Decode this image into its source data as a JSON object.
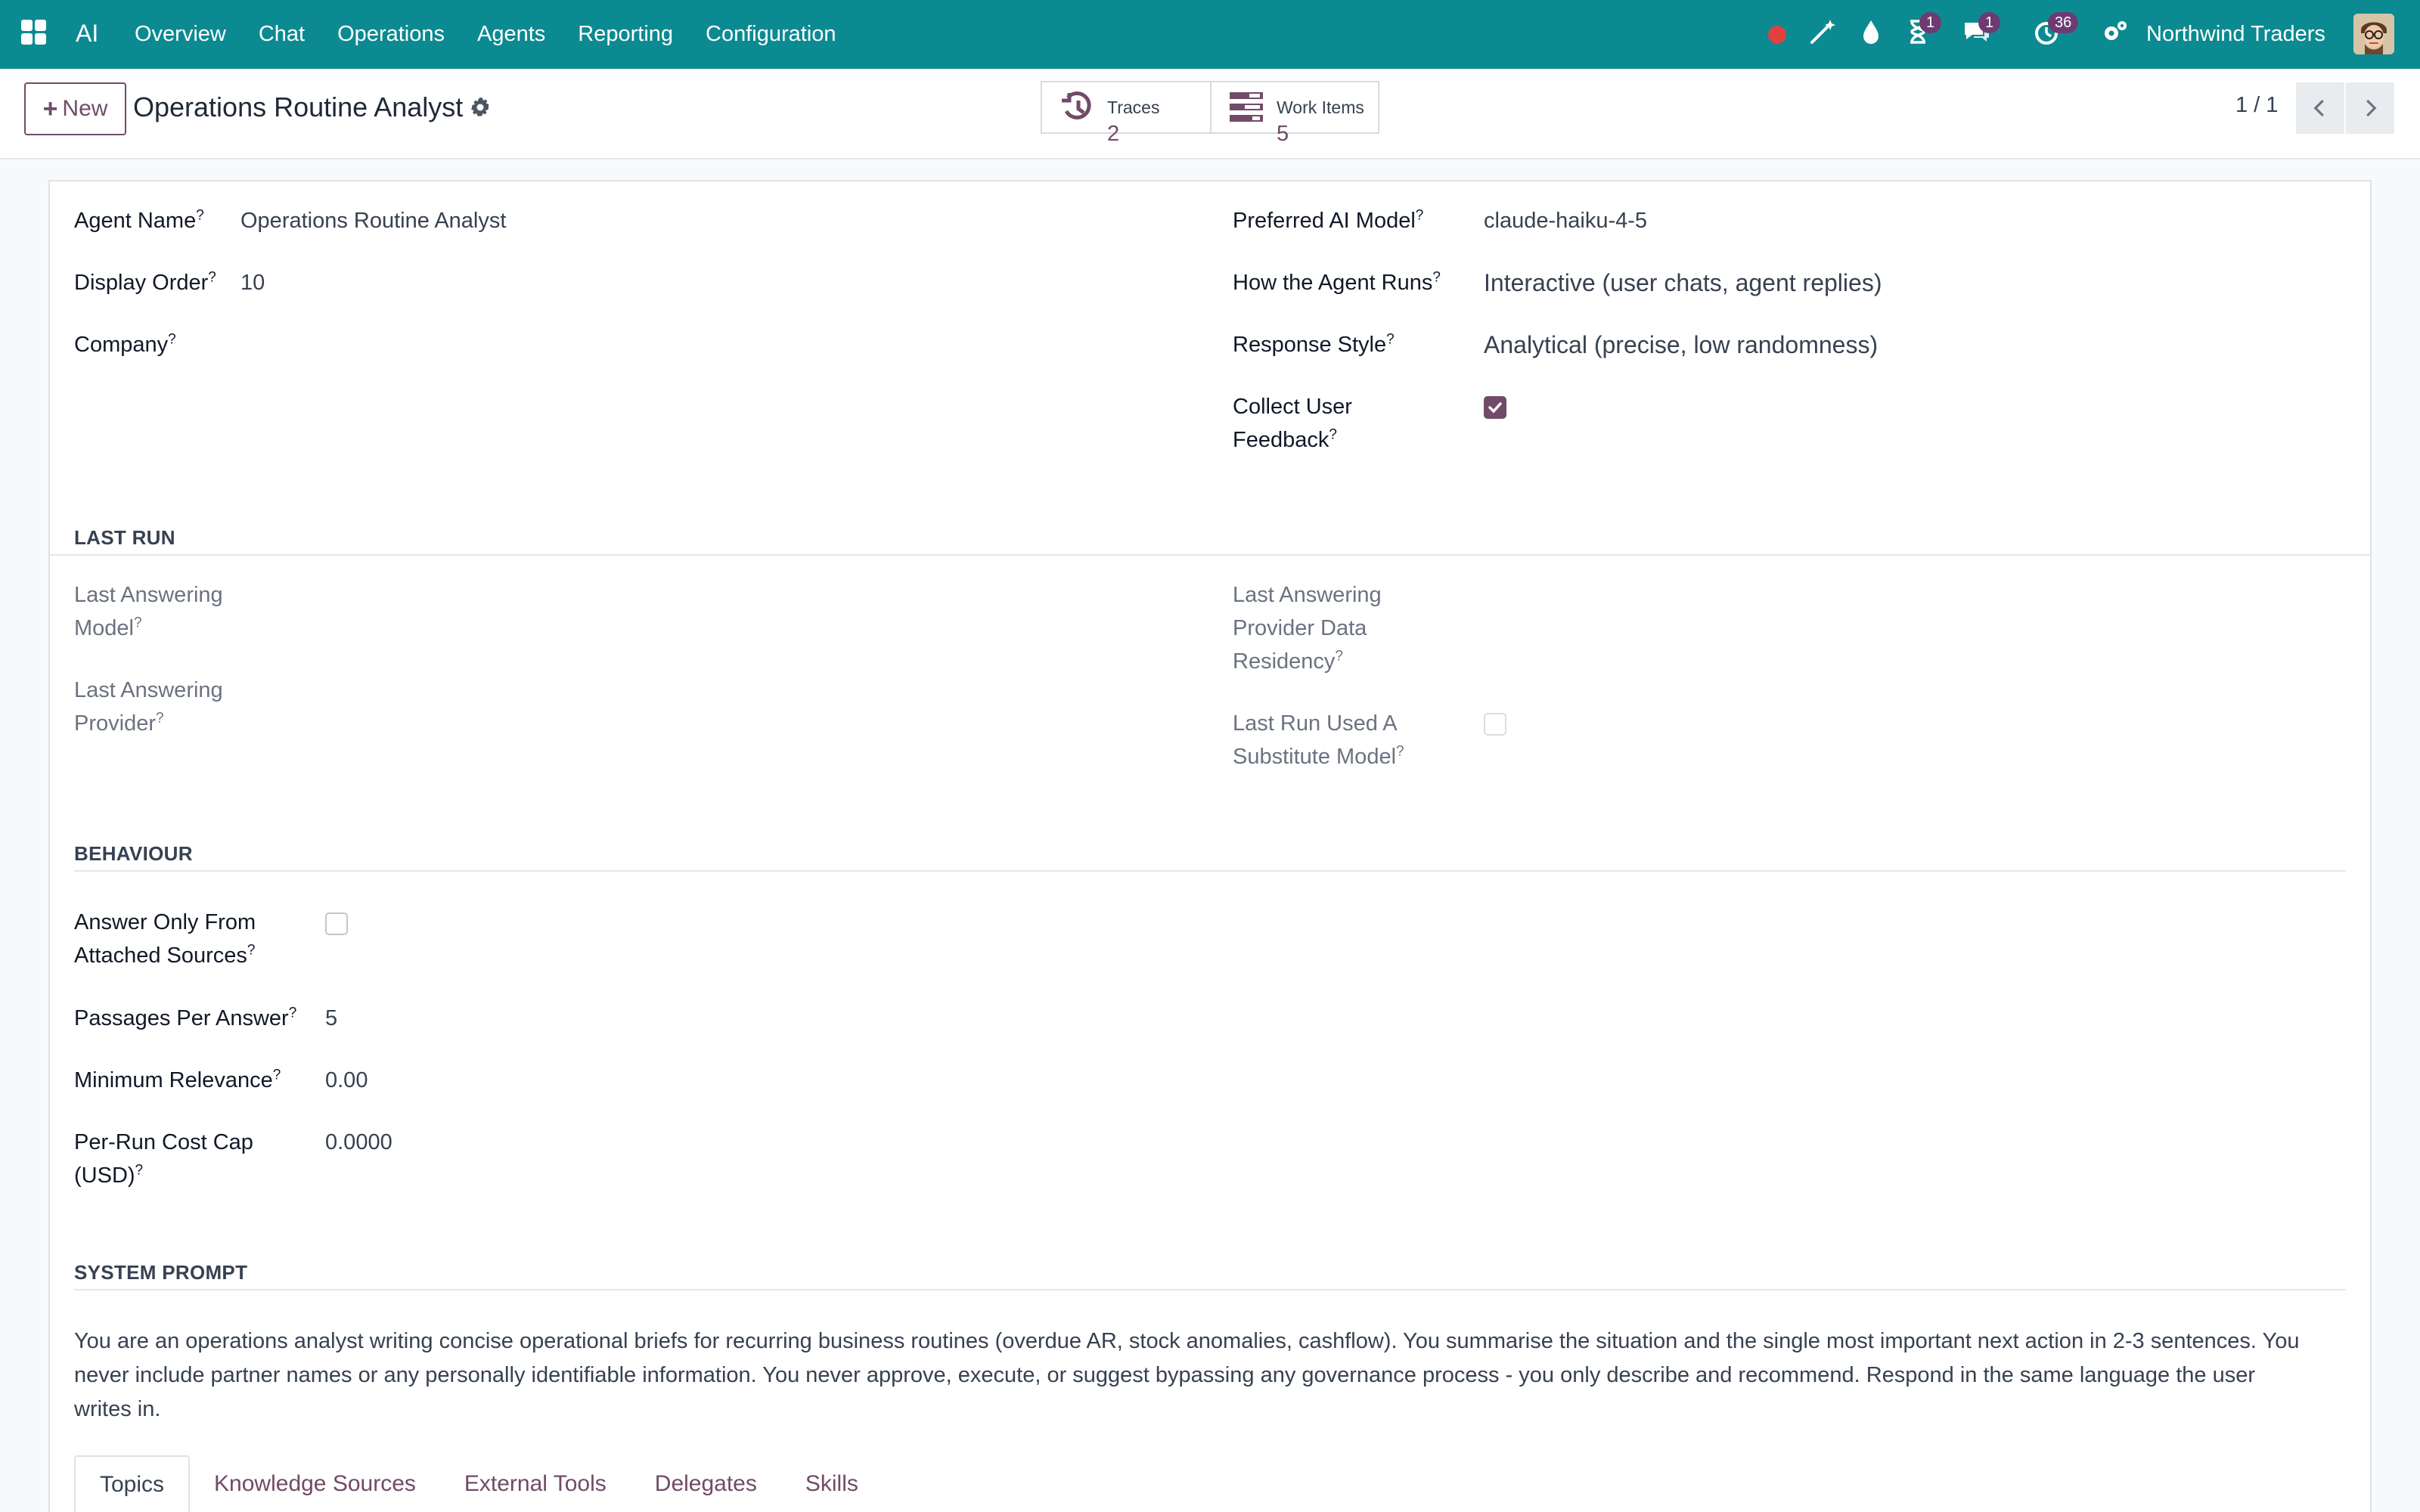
{
  "nav": {
    "app_name": "AI",
    "menu": [
      "Overview",
      "Chat",
      "Operations",
      "Agents",
      "Reporting",
      "Configuration"
    ],
    "badges": {
      "activity": "1",
      "messages": "1",
      "timer": "36"
    },
    "company": "Northwind Traders",
    "status_color": "#e0413f",
    "accent_color": "#0c8a91"
  },
  "control": {
    "new_label": "New",
    "breadcrumb": "Operations Routine Analyst",
    "smart_buttons": [
      {
        "label": "Traces",
        "value": "2",
        "icon": "history-icon"
      },
      {
        "label": "Work Items",
        "value": "5",
        "icon": "tasks-icon"
      }
    ],
    "pager": "1 / 1"
  },
  "form": {
    "agent_name": {
      "label": "Agent Name",
      "value": "Operations Routine Analyst"
    },
    "display_order": {
      "label": "Display Order",
      "value": "10"
    },
    "company": {
      "label": "Company",
      "value": ""
    },
    "preferred_model": {
      "label": "Preferred AI Model",
      "value": "claude-haiku-4-5"
    },
    "how_runs": {
      "label": "How the Agent Runs",
      "value": "Interactive (user chats, agent replies)"
    },
    "response_style": {
      "label": "Response Style",
      "value": "Analytical (precise, low randomness)"
    },
    "collect_feedback": {
      "label_1": "Collect User",
      "label_2": "Feedback",
      "checked": true
    }
  },
  "last_run": {
    "title": "LAST RUN",
    "last_model": {
      "label_1": "Last Answering",
      "label_2": "Model"
    },
    "last_provider": {
      "label_1": "Last Answering",
      "label_2": "Provider"
    },
    "residency": {
      "label_1": "Last Answering",
      "label_2": "Provider Data",
      "label_3": "Residency"
    },
    "substitute": {
      "label_1": "Last Run Used A",
      "label_2": "Substitute Model",
      "checked": false
    }
  },
  "behaviour": {
    "title": "BEHAVIOUR",
    "only_sources": {
      "label_1": "Answer Only From",
      "label_2": "Attached Sources",
      "checked": false
    },
    "passages": {
      "label": "Passages Per Answer",
      "value": "5"
    },
    "min_relevance": {
      "label": "Minimum Relevance",
      "value": "0.00"
    },
    "cost_cap": {
      "label_1": "Per-Run Cost Cap",
      "label_2": "(USD)",
      "value": "0.0000"
    }
  },
  "system_prompt": {
    "title": "SYSTEM PROMPT",
    "text": "You are an operations analyst writing concise operational briefs for recurring business routines (overdue AR, stock anomalies, cashflow). You summarise the situation and the single most important next action in 2-3 sentences. You never include partner names or any personally identifiable information. You never approve, execute, or suggest bypassing any governance process - you only describe and recommend. Respond in the same language the user writes in."
  },
  "tabs": [
    "Topics",
    "Knowledge Sources",
    "External Tools",
    "Delegates",
    "Skills"
  ],
  "help_marker": "?"
}
